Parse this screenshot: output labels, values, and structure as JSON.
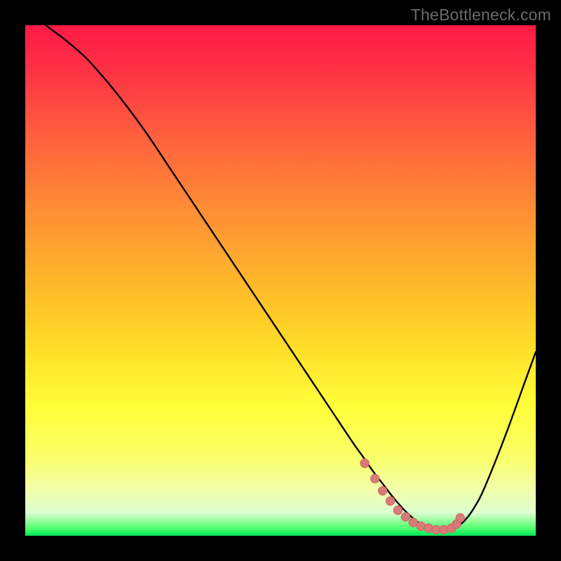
{
  "watermark": "TheBottleneck.com",
  "colors": {
    "bg": "#000000",
    "gradient_stops": [
      {
        "offset": 0.0,
        "color": "#ff1a46"
      },
      {
        "offset": 0.08,
        "color": "#ff2f45"
      },
      {
        "offset": 0.2,
        "color": "#ff5a3f"
      },
      {
        "offset": 0.35,
        "color": "#ff8a35"
      },
      {
        "offset": 0.5,
        "color": "#ffb62a"
      },
      {
        "offset": 0.63,
        "color": "#ffdd27"
      },
      {
        "offset": 0.75,
        "color": "#ffff3a"
      },
      {
        "offset": 0.85,
        "color": "#f9ff6b"
      },
      {
        "offset": 0.91,
        "color": "#f1ffab"
      },
      {
        "offset": 0.955,
        "color": "#dcffd0"
      },
      {
        "offset": 0.985,
        "color": "#54ff6f"
      },
      {
        "offset": 1.0,
        "color": "#00e85a"
      }
    ],
    "curve": "#000000",
    "marker_fill": "#d87b78",
    "marker_stroke": "#c96763"
  },
  "chart_data": {
    "type": "line",
    "title": "",
    "xlabel": "",
    "ylabel": "",
    "xlim": [
      0,
      100
    ],
    "ylim": [
      0,
      100
    ],
    "series": [
      {
        "name": "bottleneck-curve",
        "x": [
          4,
          8,
          12,
          16,
          20,
          24,
          28,
          32,
          36,
          40,
          44,
          48,
          52,
          56,
          60,
          64,
          66,
          68,
          70,
          72,
          74,
          76,
          78,
          80,
          82,
          84,
          86,
          88,
          90,
          94,
          98,
          100
        ],
        "y": [
          100,
          97,
          93.5,
          89,
          84,
          78.5,
          72.5,
          66.5,
          60.5,
          54.5,
          48.5,
          42.5,
          36.5,
          30.5,
          24.5,
          18.5,
          15.7,
          12.8,
          10.2,
          7.6,
          5.3,
          3.4,
          2.0,
          1.2,
          1.1,
          1.5,
          2.9,
          5.6,
          9.5,
          19.5,
          30.5,
          36
        ]
      }
    ],
    "markers": {
      "name": "highlight-dots",
      "x": [
        66.5,
        68.5,
        70,
        71.5,
        73,
        74.5,
        76,
        77.5,
        79,
        80.5,
        82,
        83.5,
        84.5,
        85.2
      ],
      "y": [
        14.2,
        11.2,
        8.8,
        6.8,
        5.0,
        3.7,
        2.6,
        1.9,
        1.5,
        1.2,
        1.2,
        1.5,
        2.3,
        3.5
      ]
    }
  }
}
